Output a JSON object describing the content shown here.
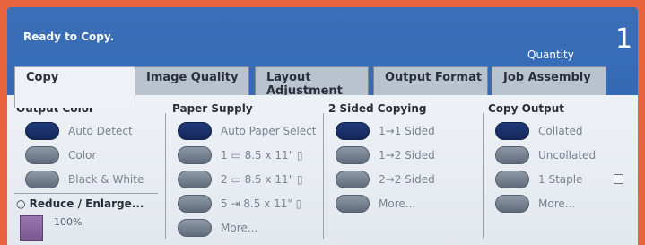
{
  "header": {
    "status": "Ready to Copy.",
    "quantity_label": "Quantity",
    "quantity_value": "1"
  },
  "tabs": [
    {
      "label": "Copy",
      "active": true
    },
    {
      "label": "Image Quality",
      "active": false
    },
    {
      "label": "Layout Adjustment",
      "active": false
    },
    {
      "label": "Output Format",
      "active": false
    },
    {
      "label": "Job Assembly",
      "active": false
    }
  ],
  "output_color": {
    "title": "Output Color",
    "options": [
      "Auto Detect",
      "Color",
      "Black & White"
    ],
    "selected": "Auto Detect"
  },
  "reduce_enlarge": {
    "title": "Reduce / Enlarge...",
    "value": "100%"
  },
  "paper_supply": {
    "title": "Paper Supply",
    "options": [
      {
        "label": "Auto Paper Select"
      },
      {
        "tray": "1",
        "label": "8.5 x 11\""
      },
      {
        "tray": "2",
        "label": "8.5 x 11\""
      },
      {
        "tray": "5",
        "label": "8.5 x 11\""
      },
      {
        "label": "More..."
      }
    ],
    "selected": "Auto Paper Select"
  },
  "two_sided": {
    "title": "2 Sided Copying",
    "options": [
      "1→1 Sided",
      "1→2 Sided",
      "2→2 Sided",
      "More..."
    ],
    "selected": "1→1 Sided"
  },
  "copy_output": {
    "title": "Copy Output",
    "options": [
      "Collated",
      "Uncollated",
      "1 Staple",
      "More..."
    ],
    "selected": "Collated"
  },
  "colors": {
    "frame": "#e8643c",
    "header_blue": "#2d62ad",
    "selected_button": "#1f3a78",
    "unselected_button": "#7d8898",
    "panel": "#eef1f5"
  }
}
